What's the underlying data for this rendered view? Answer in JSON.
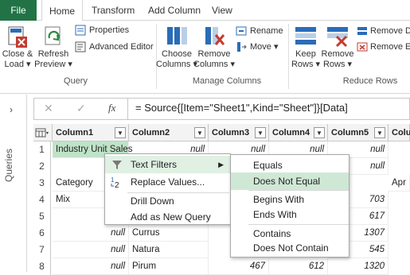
{
  "tabs": [
    "File",
    "Home",
    "Transform",
    "Add Column",
    "View"
  ],
  "ribbon": {
    "close_load": [
      "Close &",
      "Load ▾"
    ],
    "refresh": [
      "Refresh",
      "Preview ▾"
    ],
    "properties": "Properties",
    "advanced_editor": "Advanced Editor",
    "choose_columns": [
      "Choose",
      "Columns ▾"
    ],
    "remove_columns": [
      "Remove",
      "Columns ▾"
    ],
    "rename": "Rename",
    "move": "Move ▾",
    "keep_rows": [
      "Keep",
      "Rows ▾"
    ],
    "remove_rows": [
      "Remove",
      "Rows ▾"
    ],
    "remove_d": "Remove D",
    "remove_e": "Remove E",
    "groups": [
      "Query",
      "Manage Columns",
      "Reduce Rows"
    ],
    "colors": {
      "green": "#217346",
      "blue": "#2a6cb8",
      "red": "#c43b2d"
    }
  },
  "queries_label": "Queries",
  "formula_bar": {
    "cancel": "✕",
    "commit": "✓",
    "fx": "fx",
    "formula": "= Source{[Item=\"Sheet1\",Kind=\"Sheet\"]}[Data]"
  },
  "grid": {
    "headers": [
      "Column1",
      "Column2",
      "Column3",
      "Column4",
      "Column5",
      "Colum"
    ],
    "rows": [
      {
        "n": "1",
        "c1": "Industry Unit Sales",
        "c2": "null",
        "c3": "null",
        "c4": "null",
        "c5": "null"
      },
      {
        "n": "2",
        "c1": "",
        "c2": "",
        "c3": "",
        "c4": "",
        "c5": "null"
      },
      {
        "n": "3",
        "c1": "Category",
        "c2": "",
        "c3": "",
        "c4": "",
        "c5": "",
        "c6": "Apr"
      },
      {
        "n": "4",
        "c1": "Mix",
        "c2": "",
        "c3": "",
        "c4": "",
        "c5": "703"
      },
      {
        "n": "5",
        "c1": "",
        "c2": "",
        "c3": "",
        "c4": "",
        "c5": "617"
      },
      {
        "n": "6",
        "c1": "null",
        "c2": "Currus",
        "c3": "",
        "c4": "",
        "c5": "1307"
      },
      {
        "n": "7",
        "c1": "null",
        "c2": "Natura",
        "c3": "",
        "c4": "",
        "c5": "545"
      },
      {
        "n": "8",
        "c1": "null",
        "c2": "Pirum",
        "c3": "467",
        "c4": "612",
        "c5": "1320"
      }
    ]
  },
  "context_menu": {
    "items": [
      "Text Filters",
      "Replace Values...",
      "Drill Down",
      "Add as New Query"
    ]
  },
  "submenu": {
    "items": [
      "Equals",
      "Does Not Equal",
      "Begins With",
      "Ends With",
      "Contains",
      "Does Not Contain"
    ]
  }
}
